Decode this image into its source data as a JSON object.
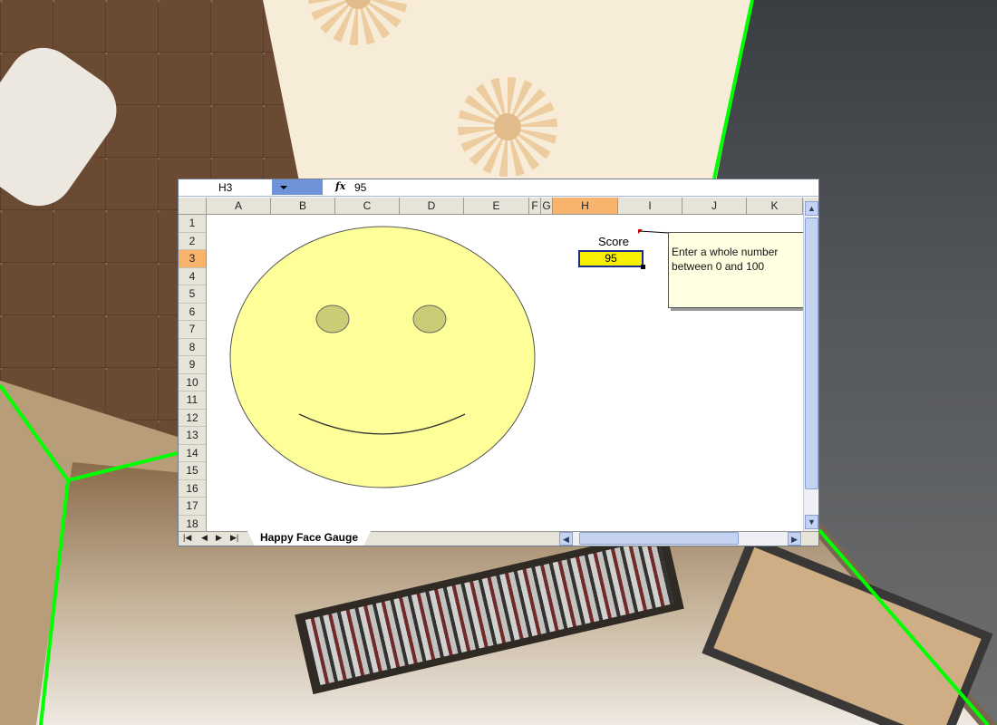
{
  "formula_bar": {
    "cell_reference": "H3",
    "fx_label": "fx",
    "formula_value": "95"
  },
  "columns": [
    "A",
    "B",
    "C",
    "D",
    "E",
    "F",
    "G",
    "H",
    "I",
    "J",
    "K"
  ],
  "selected_column": "H",
  "rows": [
    "1",
    "2",
    "3",
    "4",
    "5",
    "6",
    "7",
    "8",
    "9",
    "10",
    "11",
    "12",
    "13",
    "14",
    "15",
    "16",
    "17",
    "18"
  ],
  "selected_row": "3",
  "score": {
    "label": "Score",
    "value": "95"
  },
  "comment": {
    "text": "Enter a whole number between 0 and 100"
  },
  "smiley": {
    "face_color": "#ffff99",
    "eye_color": "#cccc77",
    "mouth_curvature": 0.95
  },
  "sheet_tabs": [
    "Happy Face Gauge"
  ],
  "active_sheet": "Happy Face Gauge",
  "colors": {
    "selection_highlight": "#f8b36c",
    "active_cell_fill": "#f8f000",
    "active_cell_border": "#1d2b8f",
    "comment_fill": "#ffffe1",
    "frame_green": "#00ff00"
  }
}
